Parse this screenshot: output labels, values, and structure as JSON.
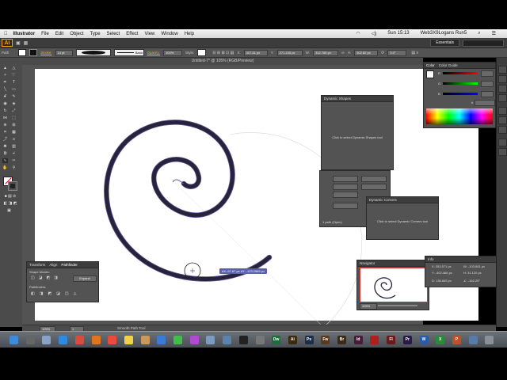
{
  "menubar": {
    "app": "Illustrator",
    "items": [
      "File",
      "Edit",
      "Object",
      "Type",
      "Select",
      "Effect",
      "View",
      "Window",
      "Help"
    ],
    "clock": "Sun 15:13",
    "user": "Web3X9Logans Run5"
  },
  "appbar": {
    "logo": "Ai",
    "workspace": "Essentials"
  },
  "control": {
    "selection": "Path",
    "stroke_label": "Stroke:",
    "stroke_value": "14 pt",
    "basic_label": "Basic",
    "opacity_label": "Opacity:",
    "opacity_value": "100%",
    "style_label": "Style:",
    "x_value": "307.81 px",
    "y_value": "271.245 px",
    "w_value": "312.765 px",
    "h_value": "302.82 px",
    "angle_value": "0.0°"
  },
  "document": {
    "title": "Untitled-7* @ 105% (RGB/Preview)"
  },
  "panels": {
    "dynamic_shapes": {
      "title": "Dynamic Shapes",
      "message": "Click to select Dynamic Shapes tool",
      "path_label": "1 path (Open)"
    },
    "dynamic_corners": {
      "title": "Dynamic Corners",
      "message": "Click to select Dynamic Corners tool"
    },
    "color": {
      "tabs": [
        "Color",
        "Color Guide"
      ],
      "channels": [
        "R",
        "G",
        "B"
      ],
      "hex_prefix": "#"
    },
    "pathfinder": {
      "tabs": [
        "Transform",
        "Align",
        "Pathfinder"
      ],
      "shape_modes_label": "Shape Modes:",
      "expand_label": "Expand",
      "pathfinders_label": "Pathfinders:"
    },
    "navigator": {
      "title": "Navigator",
      "zoom": "105%"
    },
    "info": {
      "title": "Info",
      "x": "X: 353.571 px",
      "y": "Y: -402.466 px",
      "d": "D: 136.845 px",
      "w": "W: -103.681 px",
      "h": "H: 31.120 px",
      "angle": "∠: -162.29°"
    }
  },
  "canvas": {
    "tooltip": "dX:-97.87 px  dY: -123.2589 px",
    "spiral_color": "#26243a"
  },
  "statusbar": {
    "zoom": "105%",
    "page": "1",
    "tool": "Smooth Path Tool"
  },
  "dock_apps": [
    {
      "icon": "finder-icon",
      "color": "#3d8bd9",
      "label": ""
    },
    {
      "icon": "dashboard-icon",
      "color": "#666666",
      "label": ""
    },
    {
      "icon": "mail-icon",
      "color": "#8aa2c8",
      "label": ""
    },
    {
      "icon": "safari-icon",
      "color": "#2f8be0",
      "label": ""
    },
    {
      "icon": "chrome-icon",
      "color": "#d94b3b",
      "label": ""
    },
    {
      "icon": "firefox-icon",
      "color": "#e0751e",
      "label": ""
    },
    {
      "icon": "calendar-icon",
      "color": "#e94b3c",
      "label": ""
    },
    {
      "icon": "notes-icon",
      "color": "#f0d24a",
      "label": ""
    },
    {
      "icon": "contacts-icon",
      "color": "#c79a5a",
      "label": ""
    },
    {
      "icon": "app-store-icon",
      "color": "#3a7bd5",
      "label": ""
    },
    {
      "icon": "facetime-icon",
      "color": "#3fbf4a",
      "label": ""
    },
    {
      "icon": "itunes-icon",
      "color": "#b14ad0",
      "label": ""
    },
    {
      "icon": "iphoto-icon",
      "color": "#7b9bbf",
      "label": ""
    },
    {
      "icon": "preview-icon",
      "color": "#5a84b0",
      "label": ""
    },
    {
      "icon": "terminal-icon",
      "color": "#222222",
      "label": ""
    },
    {
      "icon": "system-prefs-icon",
      "color": "#777777",
      "label": ""
    },
    {
      "icon": "dreamweaver-icon",
      "color": "#1c6e3a",
      "label": "Dw"
    },
    {
      "icon": "illustrator-icon",
      "color": "#3a2a10",
      "label": "Ai"
    },
    {
      "icon": "photoshop-icon",
      "color": "#1b2e4a",
      "label": "Ps"
    },
    {
      "icon": "fireworks-icon",
      "color": "#5a3a1a",
      "label": "Fw"
    },
    {
      "icon": "bridge-icon",
      "color": "#3a2a1a",
      "label": "Br"
    },
    {
      "icon": "indesign-icon",
      "color": "#4a1a3a",
      "label": "Id"
    },
    {
      "icon": "acrobat-icon",
      "color": "#b0201a",
      "label": ""
    },
    {
      "icon": "flash-icon",
      "color": "#6a1a1a",
      "label": "Fl"
    },
    {
      "icon": "premiere-icon",
      "color": "#2a1a4a",
      "label": "Pr"
    },
    {
      "icon": "word-icon",
      "color": "#2a5aa8",
      "label": "W"
    },
    {
      "icon": "excel-icon",
      "color": "#2a8a3a",
      "label": "X"
    },
    {
      "icon": "powerpoint-icon",
      "color": "#c0502a",
      "label": "P"
    },
    {
      "icon": "downloads-icon",
      "color": "#5a7aa8",
      "label": ""
    },
    {
      "icon": "trash-icon",
      "color": "#8a9098",
      "label": ""
    }
  ]
}
